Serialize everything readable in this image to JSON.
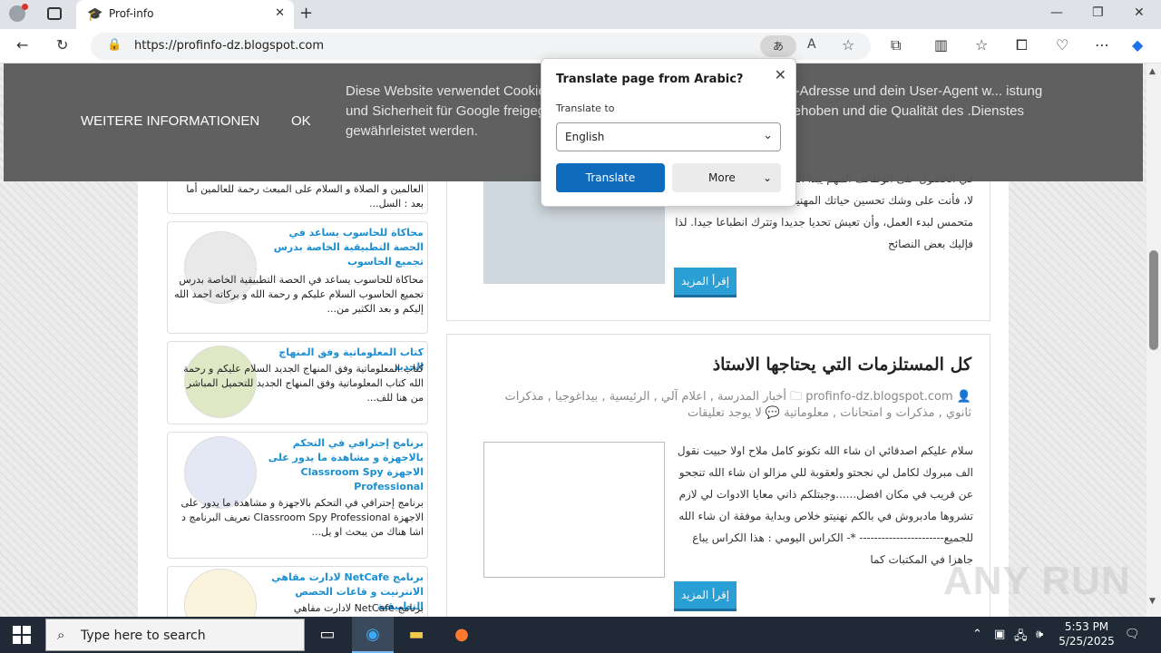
{
  "browser": {
    "tab_title": "Prof-info",
    "url": "https://profinfo-dz.blogspot.com",
    "translate_badge": "あ"
  },
  "cookie_bar": {
    "more_info": "WEITERE INFORMATIONEN",
    "ok": "OK",
    "message": "Diese Website verwendet Cookies ... und Zugriffe zu analysieren. Deine IP-Adresse und dein User-Agent w... istung und Sicherheit für Google freigegeben. So können Nutzun... erkannt und behoben und die Qualität des .Dienstes gewährleistet werden."
  },
  "translate_popup": {
    "title": "Translate page from Arabic?",
    "label": "Translate to",
    "language": "English",
    "translate_btn": "Translate",
    "more_btn": "More"
  },
  "sidebar": {
    "cards": [
      {
        "title": "",
        "body": "العالمين و الصلاة و السلام على المبعث رحمة للعالمين أما بعد : السل..."
      },
      {
        "title": "محاكاة للحاسوب يساعد في الحصة التطبيقية الخاصة بدرس تجميع الحاسوب",
        "body": "محاكاة للحاسوب يساعد في الحصة التطبيقية الخاصة بدرس تجميع الحاسوب السلام عليكم و رحمة الله و بركاته احمد الله إليكم و بعد الكثير من..."
      },
      {
        "title": "كتاب المعلوماتية وفق المنهاج الجديد",
        "body": "كتاب المعلوماتية وفق المنهاج الجديد السلام عليكم و رحمة الله كتاب المعلوماتية وفق المنهاج الجديد للتحميل المباشر من هنا للف..."
      },
      {
        "title": "برنامج إحترافي في التحكم بالاجهزة و مشاهدة ما يدور على الاجهزة Classroom Spy Professional",
        "body": "برنامج إحترافي في التحكم بالاجهزة و مشاهدة ما يدور على الاجهزة Classroom Spy Professional تعريف البرنامج د اشا هناك من يبحث او يل..."
      },
      {
        "title": "برنامج NetCafe لادارت مقاهي الانترنيت و قاعات الحصص التطبيقية",
        "body": "برنامج NetCafe لادارت مقاهي"
      }
    ]
  },
  "posts": {
    "first": {
      "excerpt": "في الحصول على الوظائف المهم يبدأ الموضوع وظيفتك الأولى أم لا، فأنت على وشك تحسين حياتك المهنية. في أول يوم عمل أنت متحمس لبدء العمل، وأن تعيش تحديا جديدا وتترك انطباعا جيدا. لذا فإليك بعض النصائح",
      "read_more": "إقرأ المزيد"
    },
    "second": {
      "title": "كل المستلزمات التي يحتاجها الاستاذ",
      "author": "profinfo-dz.blogspot.com",
      "labels": "أخبار المدرسة , اعلام آلي , الرئيسية , بيداغوجيا , مذكرات ثانوي , مذكرات و امتحانات , معلوماتية",
      "comments": "لا يوجد تعليقات",
      "excerpt": "سلام عليكم اصدقائي ان شاء الله تكونو كامل ملاح اولا حبيت نقول الف مبروك لكامل لي نجحتو ولعقوبة للي مزالو ان شاء الله تنجحو عن قريب في مكان افضل......وجبتلكم ذاني معايا الادوات لي لازم تشروها مادبروش في بالكم نهنيتو خلاص وبداية موفقة ان شاء الله للجميع----------------------- *- الكراس اليومي : هذا الكراس يباع جاهزا في المكتبات كما",
      "read_more": "إقرأ المزيد"
    }
  },
  "taskbar": {
    "search_placeholder": "Type here to search",
    "time": "5:53 PM",
    "date": "5/25/2025"
  },
  "watermark": "ANY RUN"
}
